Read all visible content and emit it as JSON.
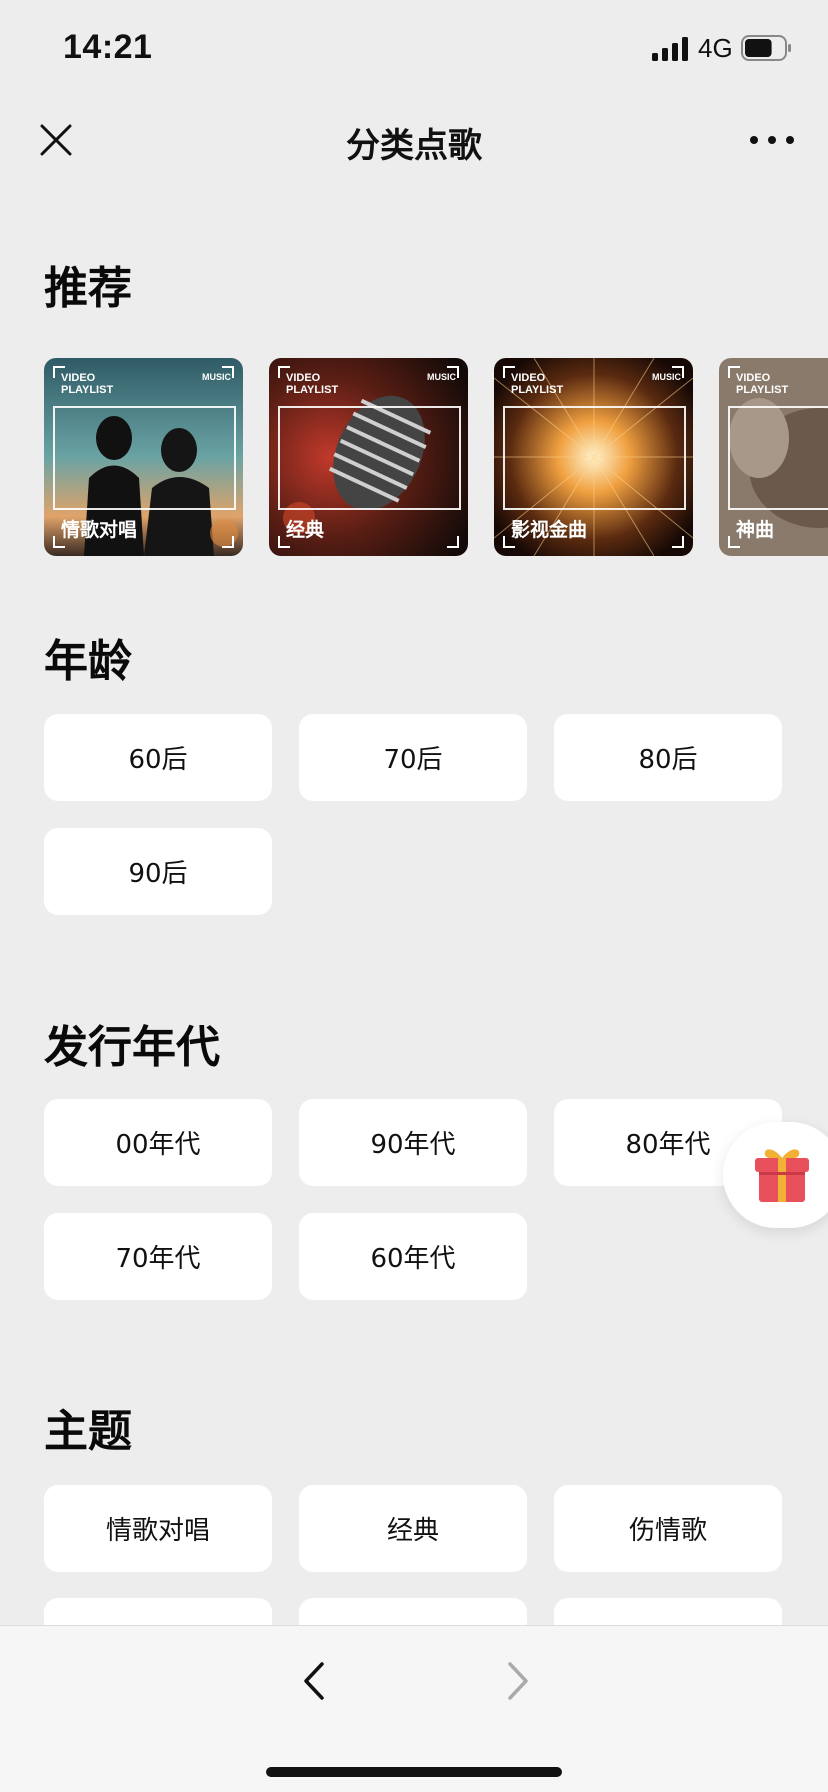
{
  "status": {
    "time": "14:21",
    "network": "4G",
    "battery_level": 0.7
  },
  "nav": {
    "title": "分类点歌",
    "close_icon": "close-icon",
    "more_icon": "more-dots-icon"
  },
  "recommend": {
    "title": "推荐",
    "frame_tag_line1": "VIDEO",
    "frame_tag_line2": "PLAYLIST",
    "brand": "MUSIC",
    "cards": [
      {
        "label": "情歌对唱"
      },
      {
        "label": "经典"
      },
      {
        "label": "影视金曲"
      },
      {
        "label": "神曲"
      }
    ]
  },
  "age": {
    "title": "年龄",
    "items": [
      "60后",
      "70后",
      "80后",
      "90后"
    ]
  },
  "era": {
    "title": "发行年代",
    "items": [
      "00年代",
      "90年代",
      "80年代",
      "70年代",
      "60年代"
    ]
  },
  "theme": {
    "title": "主题",
    "items": [
      "情歌对唱",
      "经典",
      "伤情歌"
    ]
  },
  "icons": {
    "gift": "gift-icon",
    "back": "chevron-left-icon",
    "forward": "chevron-right-icon"
  },
  "colors": {
    "background": "#ededed",
    "gift_red": "#e8505b",
    "gift_gold": "#f2b134"
  }
}
